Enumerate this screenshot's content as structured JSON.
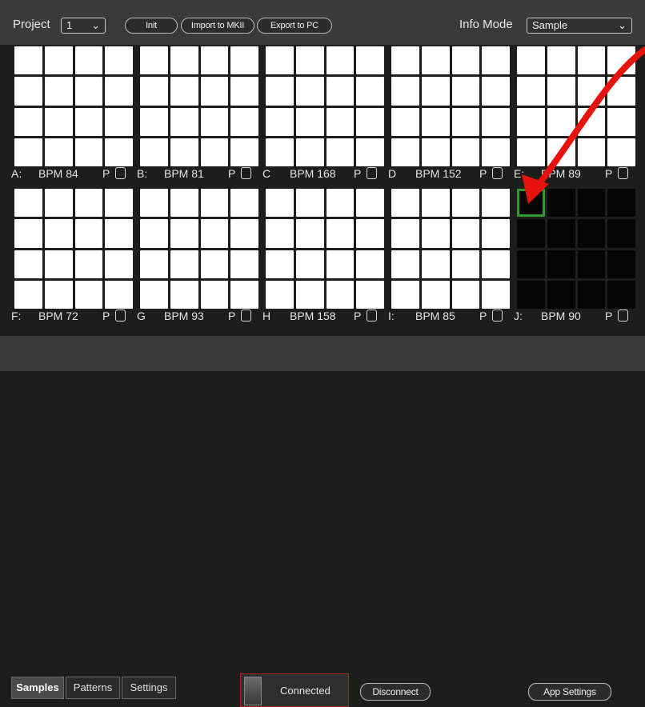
{
  "toolbar": {
    "project_label": "Project",
    "project_value": "1",
    "init_label": "Init",
    "import_label": "Import to MKII",
    "export_label": "Export to PC",
    "info_mode_label": "Info Mode",
    "info_mode_value": "Sample"
  },
  "banks": [
    {
      "id": "A",
      "label": "A:",
      "bpm": "BPM 84",
      "p": "P",
      "loaded": true
    },
    {
      "id": "B",
      "label": "B:",
      "bpm": "BPM 81",
      "p": "P",
      "loaded": true
    },
    {
      "id": "C",
      "label": "C",
      "bpm": "BPM 168",
      "p": "P",
      "loaded": true
    },
    {
      "id": "D",
      "label": "D",
      "bpm": "BPM 152",
      "p": "P",
      "loaded": true
    },
    {
      "id": "E",
      "label": "E:",
      "bpm": "BPM 89",
      "p": "P",
      "loaded": true
    },
    {
      "id": "F",
      "label": "F:",
      "bpm": "BPM 72",
      "p": "P",
      "loaded": true
    },
    {
      "id": "G",
      "label": "G",
      "bpm": "BPM 93",
      "p": "P",
      "loaded": true
    },
    {
      "id": "H",
      "label": "H",
      "bpm": "BPM 158",
      "p": "P",
      "loaded": true
    },
    {
      "id": "I",
      "label": "I:",
      "bpm": "BPM 85",
      "p": "P",
      "loaded": true
    },
    {
      "id": "J",
      "label": "J:",
      "bpm": "BPM 90",
      "p": "P",
      "loaded": false
    }
  ],
  "bottom": {
    "tabs": [
      "Samples",
      "Patterns",
      "Settings"
    ],
    "active_tab": "Samples",
    "status": "Connected",
    "disconnect_label": "Disconnect",
    "app_settings_label": "App Settings"
  },
  "colors": {
    "pad_loaded": "#ffffff",
    "pad_empty": "#050505",
    "selected_outline": "#2f9a2a",
    "annotation_arrow": "#e8120c",
    "status_border": "#b02020"
  }
}
